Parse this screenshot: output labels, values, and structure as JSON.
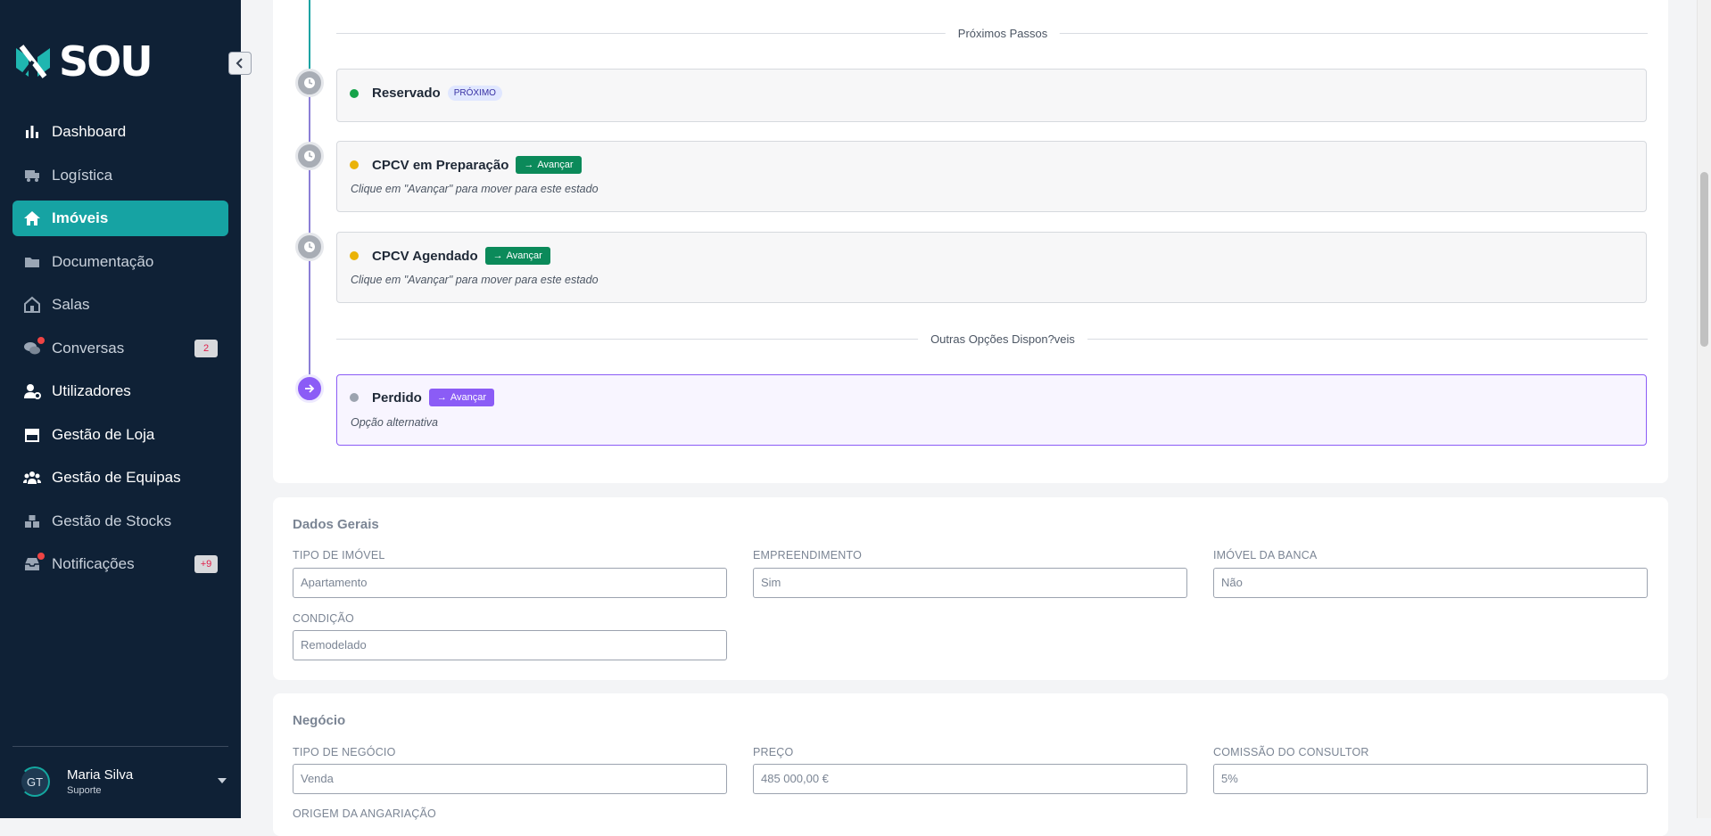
{
  "app": {
    "logo_text": "SOU",
    "collapse_icon": "chevron-left-icon"
  },
  "sidebar": {
    "items": [
      {
        "label": "Dashboard",
        "icon": "bar-chart-icon",
        "state": "bold"
      },
      {
        "label": "Logística",
        "icon": "truck-icon",
        "state": "normal"
      },
      {
        "label": "Imóveis",
        "icon": "home-icon",
        "state": "active"
      },
      {
        "label": "Documentação",
        "icon": "folder-icon",
        "state": "normal"
      },
      {
        "label": "Salas",
        "icon": "building-icon",
        "state": "normal"
      },
      {
        "label": "Conversas",
        "icon": "chat-icon",
        "state": "normal",
        "badge": "2",
        "dot": true
      },
      {
        "label": "Utilizadores",
        "icon": "user-cog-icon",
        "state": "bold"
      },
      {
        "label": "Gestão de Loja",
        "icon": "store-icon",
        "state": "bold"
      },
      {
        "label": "Gestão de Equipas",
        "icon": "users-icon",
        "state": "bold"
      },
      {
        "label": "Gestão de Stocks",
        "icon": "boxes-icon",
        "state": "normal"
      },
      {
        "label": "Notificações",
        "icon": "inbox-icon",
        "state": "normal",
        "badge": "+9",
        "dot": true
      }
    ],
    "user": {
      "initials": "GT",
      "name": "Maria Silva",
      "role": "Suporte"
    }
  },
  "timeline": {
    "next_steps_label": "Próximos Passos",
    "other_options_label": "Outras Opções Dispon?veis",
    "steps": [
      {
        "title": "Reservado",
        "status_color": "#16a34a",
        "badge": "PRÓXIMO"
      },
      {
        "title": "CPCV em Preparação",
        "status_color": "#eab308",
        "button": "Avançar",
        "note": "Clique em \"Avançar\" para mover para este estado"
      },
      {
        "title": "CPCV Agendado",
        "status_color": "#eab308",
        "button": "Avançar",
        "note": "Clique em \"Avançar\" para mover para este estado"
      }
    ],
    "alternative": {
      "title": "Perdido",
      "status_color": "#9ca3af",
      "button": "Avançar",
      "note": "Opção alternativa"
    }
  },
  "dados_gerais": {
    "title": "Dados Gerais",
    "fields": [
      {
        "label": "TIPO DE IMÓVEL",
        "value": "Apartamento"
      },
      {
        "label": "EMPREENDIMENTO",
        "value": "Sim"
      },
      {
        "label": "IMÓVEL DA BANCA",
        "value": "Não"
      },
      {
        "label": "CONDIÇÃO",
        "value": "Remodelado"
      }
    ]
  },
  "negocio": {
    "title": "Negócio",
    "fields": [
      {
        "label": "TIPO DE NEGÓCIO",
        "value": "Venda"
      },
      {
        "label": "PREÇO",
        "value": "485 000,00 €"
      },
      {
        "label": "COMISSÃO DO CONSULTOR",
        "value": "5%"
      },
      {
        "label": "ORIGEM DA ANGARIAÇÃO",
        "value": ""
      }
    ]
  },
  "colors": {
    "sidebar_bg": "#0f2136",
    "accent": "#16a3a3",
    "advance_green": "#0b8a5a",
    "advance_purple": "#8b5cf6"
  }
}
